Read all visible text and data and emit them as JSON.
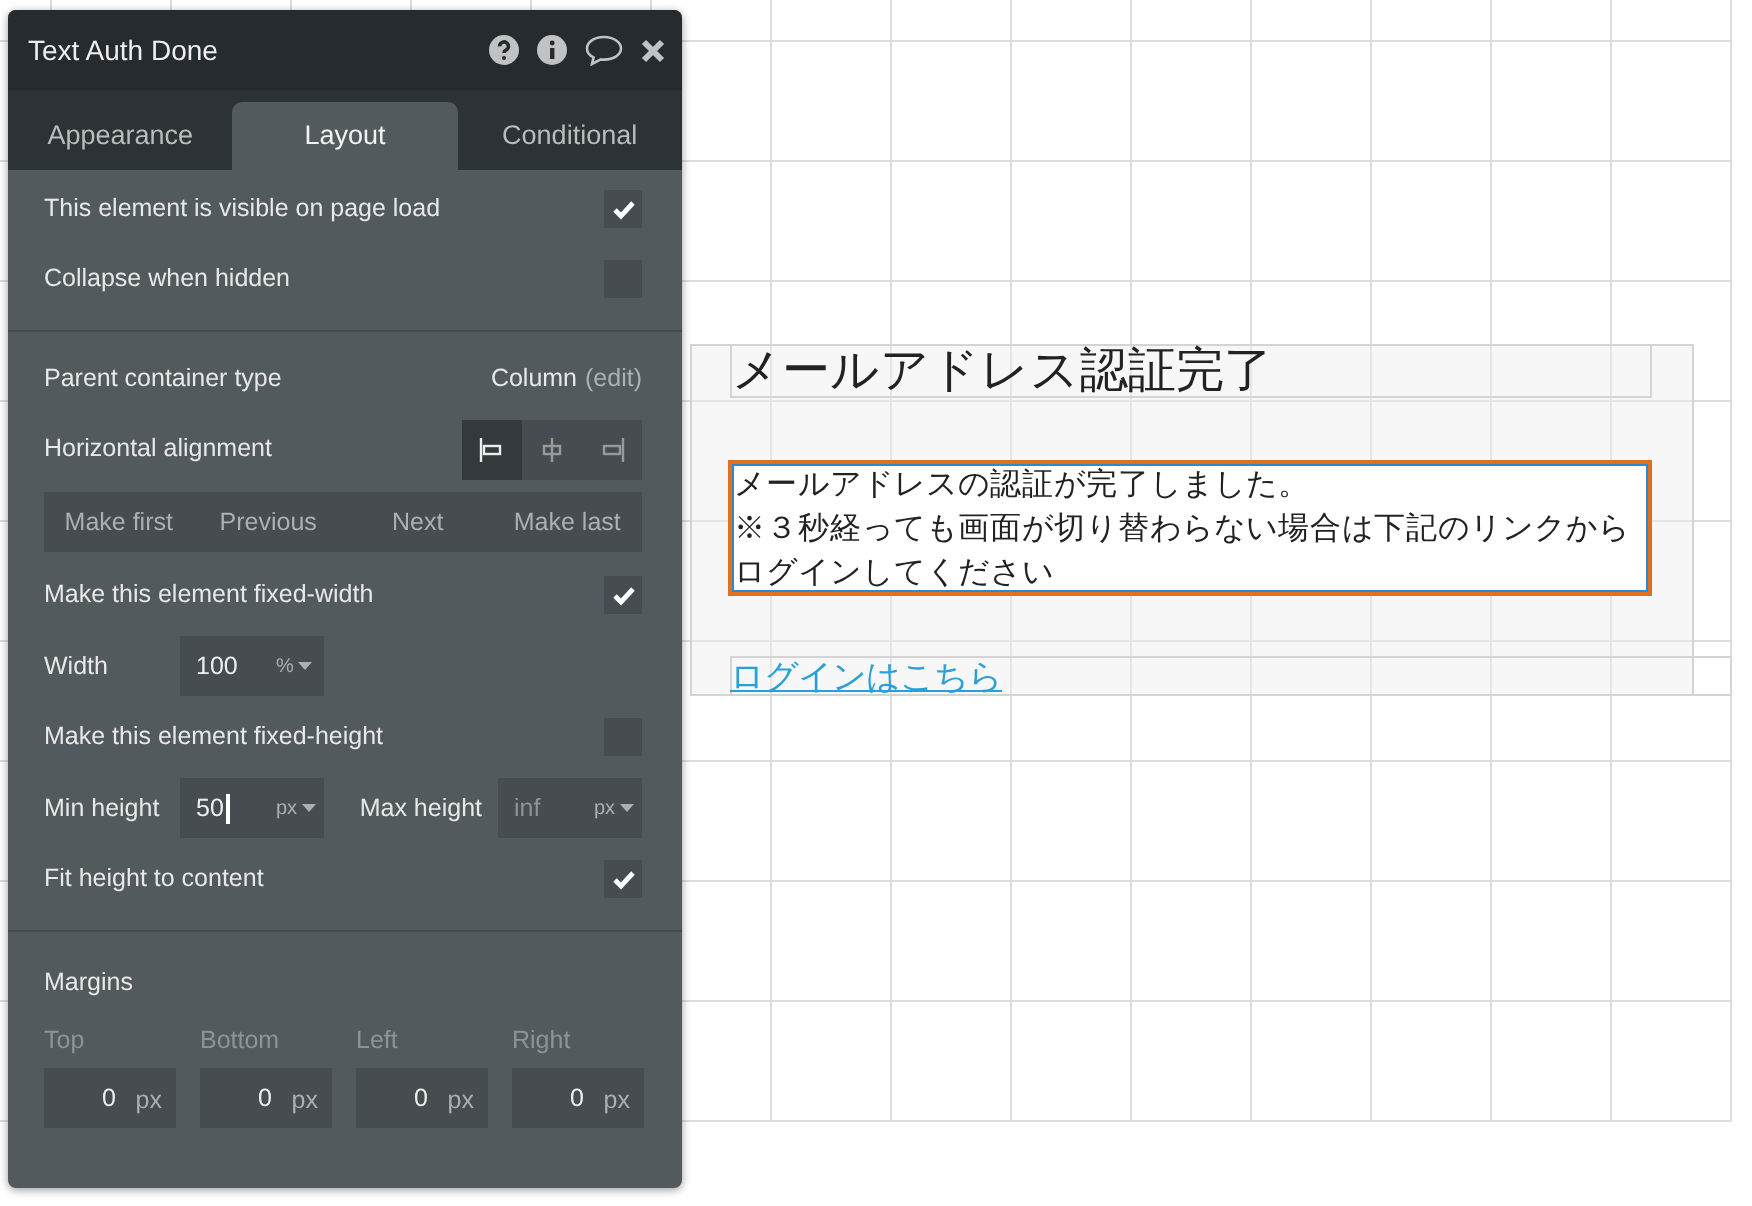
{
  "panel": {
    "title": "Text Auth Done",
    "tabs": [
      {
        "label": "Appearance",
        "selected": false
      },
      {
        "label": "Layout",
        "selected": true
      },
      {
        "label": "Conditional",
        "selected": false
      }
    ],
    "sections": [
      [
        {
          "kind": "checkbox",
          "label": "This element is visible on page load",
          "checked": true
        },
        {
          "kind": "checkbox",
          "label": "Collapse when hidden",
          "checked": false
        }
      ],
      [
        {
          "kind": "info",
          "label": "Parent container type",
          "value": "Column",
          "link": "(edit)"
        },
        {
          "kind": "alignment",
          "label": "Horizontal alignment",
          "options": [
            {
              "selected": true
            },
            {
              "selected": false
            },
            {
              "selected": false
            }
          ]
        },
        {
          "kind": "buttons",
          "buttons": [
            "Make first",
            "Previous",
            "Next",
            "Make last"
          ]
        },
        {
          "kind": "checkbox",
          "label": "Make this element fixed-width",
          "checked": true
        },
        {
          "kind": "size",
          "label": "Width",
          "value": "100",
          "unit": "%"
        },
        {
          "kind": "checkbox",
          "label": "Make this element fixed-height",
          "checked": false
        },
        {
          "kind": "minmax",
          "fields": [
            {
              "label": "Min height",
              "value": "50",
              "unit": "px",
              "focused": true
            },
            {
              "label": "Max height",
              "placeholder": "inf",
              "unit": "px",
              "focused": false
            }
          ]
        },
        {
          "kind": "checkbox",
          "label": "Fit height to content",
          "checked": true
        }
      ],
      [
        {
          "kind": "margins",
          "label": "Margins",
          "fields": [
            {
              "label": "Top",
              "value": "0",
              "unit": "px"
            },
            {
              "label": "Bottom",
              "value": "0",
              "unit": "px"
            },
            {
              "label": "Left",
              "value": "0",
              "unit": "px"
            },
            {
              "label": "Right",
              "value": "0",
              "unit": "px"
            }
          ]
        }
      ]
    ]
  },
  "canvas": {
    "heading": "メールアドレス認証完了",
    "message": {
      "selected": true,
      "lines": [
        "メールアドレスの認証が完了しました。",
        "※３秒経っても画面が切り替わらない場合は下記のリンクから",
        "ログインしてください"
      ]
    },
    "link": "ログインはこちら"
  }
}
